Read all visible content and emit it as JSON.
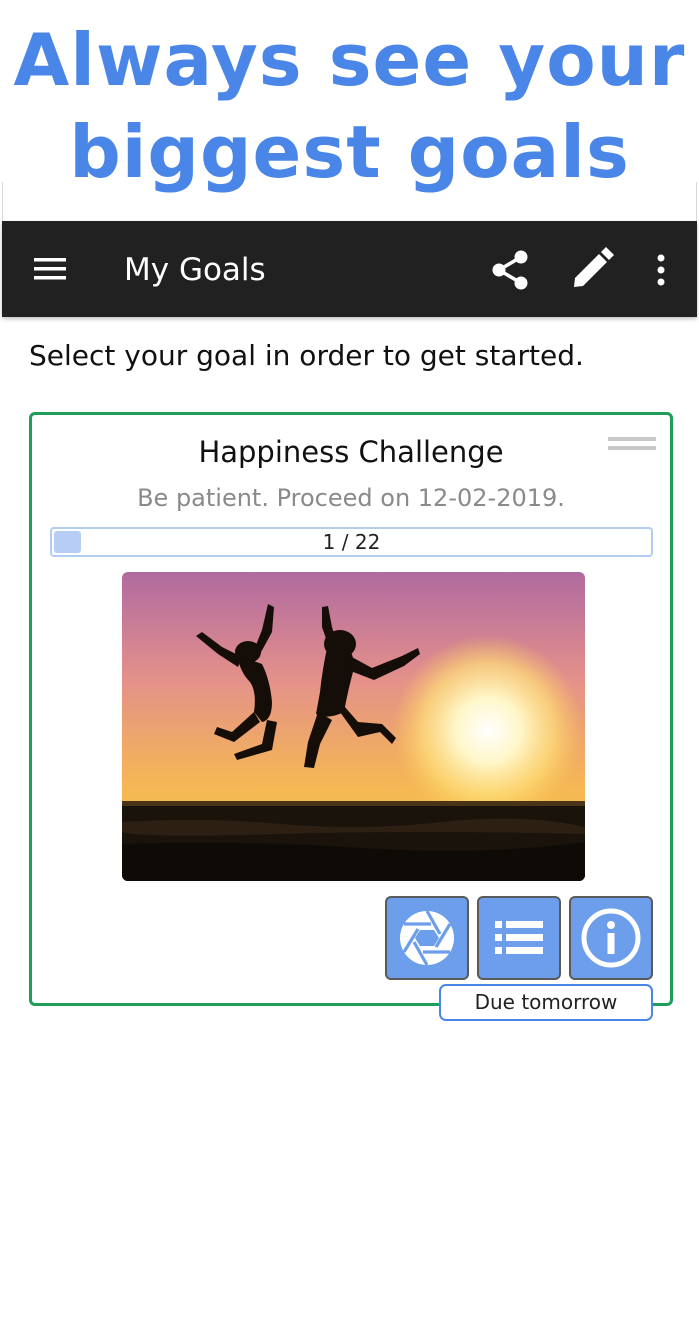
{
  "promo": {
    "line1": "Always see your",
    "line2": "biggest goals",
    "color": "#4a86e8"
  },
  "appbar": {
    "title": "My Goals",
    "background": "#212121",
    "icons": [
      "menu-icon",
      "share-icon",
      "edit-pencil-icon",
      "more-vert-icon"
    ]
  },
  "main": {
    "intro_text": "Select your goal in order to get started."
  },
  "goal_card": {
    "title": "Happiness Challenge",
    "subtitle": "Be patient. Proceed on 12-02-2019.",
    "progress": {
      "label": "1 / 22",
      "current": 1,
      "total": 22
    },
    "image": "silhouettes-jumping-at-sunset-photo",
    "border_color": "#1e9e5a",
    "actions": [
      {
        "icon": "camera-aperture-icon"
      },
      {
        "icon": "list-icon"
      },
      {
        "icon": "info-icon"
      }
    ],
    "action_color": "#6d9eeb",
    "due_badge": "Due tomorrow"
  }
}
